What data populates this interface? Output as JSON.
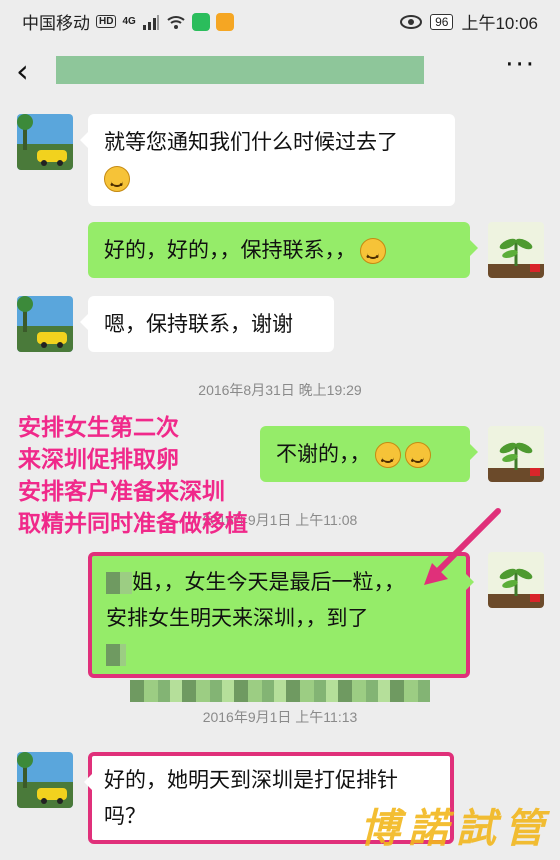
{
  "status_bar": {
    "carrier": "中国移动",
    "hd_badge": "HD",
    "network": "4G",
    "battery": "96",
    "time": "上午10:06"
  },
  "nav": {
    "back_icon": "chevron-left-icon",
    "more_icon": "more-icon",
    "more_label": "···",
    "title_redacted_color": "#8ec69a"
  },
  "messages": [
    {
      "side": "left",
      "text": "就等您通知我们什么时候过去了"
    },
    {
      "side": "right",
      "text": "好的，好的，，保持联系，，"
    },
    {
      "side": "left",
      "text": "嗯，保持联系，谢谢"
    },
    {
      "side": "right",
      "text": "不谢的，，"
    },
    {
      "side": "right",
      "text_suffix": "姐，，女生今天是最后一粒，，",
      "line2": "安排女生明天来深圳，，到了"
    },
    {
      "side": "left",
      "text": "好的，她明天到深圳是打促排针",
      "line2": "吗？"
    }
  ],
  "timestamps": [
    "2016年8月31日 晚上19:29",
    "2016年9月1日 上午11:08",
    "2016年9月1日 上午11:13"
  ],
  "annotation": {
    "lines": [
      "安排女生第二次",
      "来深圳促排取卵",
      "安排客户准备来深圳",
      "取精并同时准备做移植"
    ],
    "color": "#f0298a"
  },
  "watermark": "博諾試管",
  "colors": {
    "bubble_green": "#95ec69",
    "bubble_white": "#ffffff",
    "background": "#ededed",
    "highlight": "#e0307a"
  }
}
